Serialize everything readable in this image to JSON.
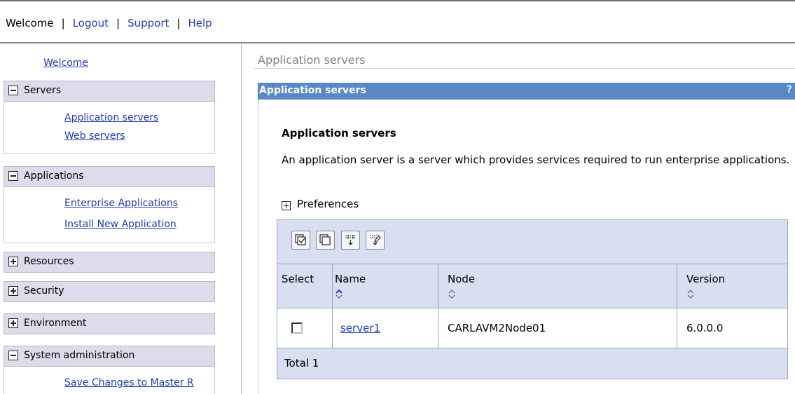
{
  "topbar": {
    "welcome": "Welcome",
    "logout": "Logout",
    "support": "Support",
    "help": "Help",
    "separator": "|"
  },
  "nav": {
    "welcome": "Welcome",
    "groups": [
      {
        "label": "Servers",
        "expanded": true,
        "items": [
          "Application servers",
          "Web servers"
        ]
      },
      {
        "label": "Applications",
        "expanded": true,
        "items": [
          "Enterprise Applications",
          "Install New Application"
        ]
      },
      {
        "label": "Resources",
        "expanded": false,
        "items": []
      },
      {
        "label": "Security",
        "expanded": false,
        "items": []
      },
      {
        "label": "Environment",
        "expanded": false,
        "items": []
      },
      {
        "label": "System administration",
        "expanded": true,
        "items": [
          "Save Changes to Master R"
        ]
      }
    ]
  },
  "breadcrumb": "Application servers",
  "portlet": {
    "title": "Application servers",
    "help": "?"
  },
  "page": {
    "title": "Application servers",
    "description": "An application server is a server which provides services required to run enterprise applications.",
    "preferences": "Preferences"
  },
  "table": {
    "toolbar_icons": [
      "select-all-icon",
      "deselect-all-icon",
      "show-filter-icon",
      "clear-filter-icon"
    ],
    "headers": {
      "select": "Select",
      "name": "Name",
      "node": "Node",
      "version": "Version"
    },
    "rows": [
      {
        "checked": false,
        "name": "server1",
        "node": "CARLAVM2Node01",
        "version": "6.0.0.0"
      }
    ],
    "total": "Total 1"
  },
  "colors": {
    "link": "#1f3db8",
    "portlet_header": "#5a89c8",
    "table_bg": "#d7dff0",
    "nav_group_bg": "#dcdcec"
  }
}
